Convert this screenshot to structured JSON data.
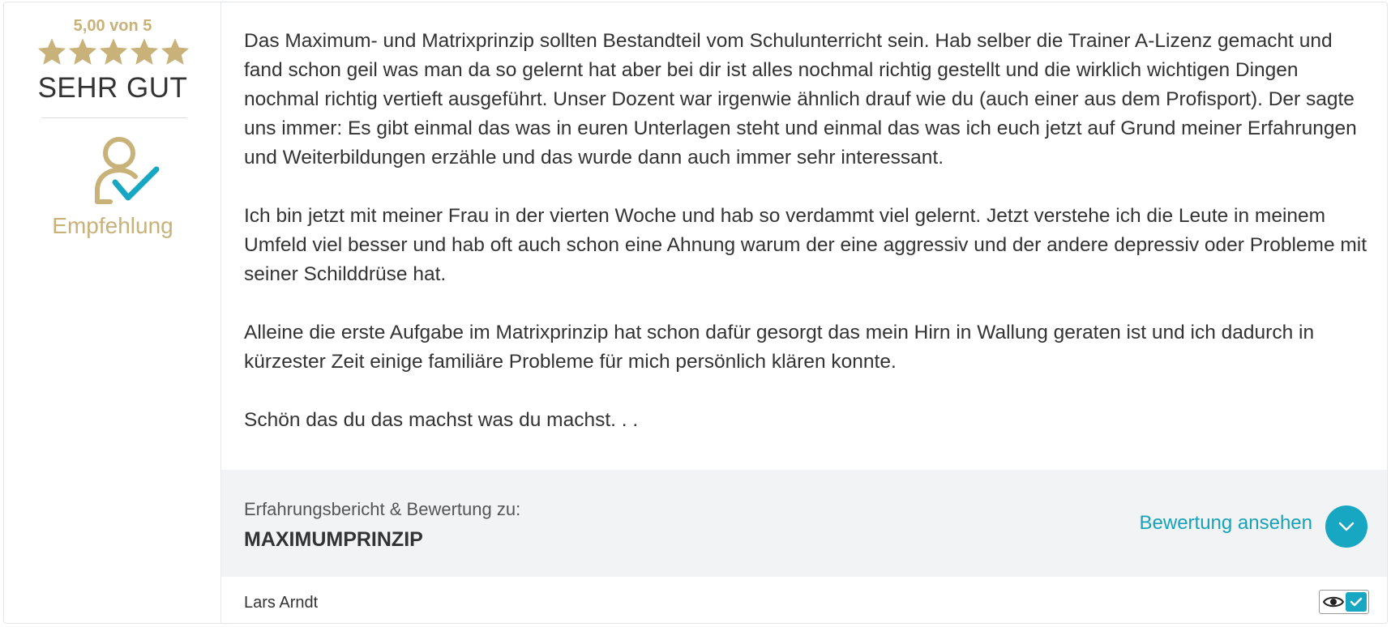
{
  "rating": {
    "score_label": "5,00 von 5",
    "stars_filled": 5,
    "stars_total": 5,
    "grade": "SEHR GUT",
    "recommendation": "Empfehlung"
  },
  "review": {
    "paragraphs": [
      "Das Maximum- und Matrixprinzip sollten Bestandteil vom Schulunterricht sein. Hab selber die Trainer A-Lizenz gemacht und fand schon geil was man da so gelernt hat aber bei dir ist alles nochmal richtig gestellt und die wirklich wichtigen Dingen nochmal richtig vertieft ausgeführt. Unser Dozent war irgenwie ähnlich drauf wie du (auch einer aus dem Profisport). Der sagte uns immer: Es gibt einmal das was in euren Unterlagen steht und einmal das was ich euch jetzt auf Grund meiner Erfahrungen und Weiterbildungen erzähle und das wurde dann auch immer sehr interessant.",
      "Ich bin jetzt mit meiner Frau in der vierten Woche und hab so verdammt viel gelernt. Jetzt verstehe ich die Leute in meinem Umfeld viel besser und hab oft auch schon eine Ahnung warum der eine aggressiv und der andere depressiv oder Probleme mit seiner Schilddrüse hat.",
      "Alleine die erste Aufgabe im Matrixprinzip hat schon dafür gesorgt das mein Hirn in Wallung geraten ist und ich dadurch in kürzester Zeit einige familiäre Probleme für mich persönlich klären konnte.",
      "Schön das du das machst was du machst. . ."
    ]
  },
  "meta": {
    "label": "Erfahrungsbericht & Bewertung zu:",
    "product": "MAXIMUMPRINZIP",
    "view_link": "Bewertung ansehen"
  },
  "author": "Lars Arndt",
  "colors": {
    "gold": "#c9b27a",
    "accent": "#17a7c2"
  },
  "icons": {
    "star": "star-icon",
    "recommendation": "user-check-icon",
    "expand": "chevron-down-icon",
    "visibility": "eye-icon",
    "verified": "checkmark-icon"
  }
}
